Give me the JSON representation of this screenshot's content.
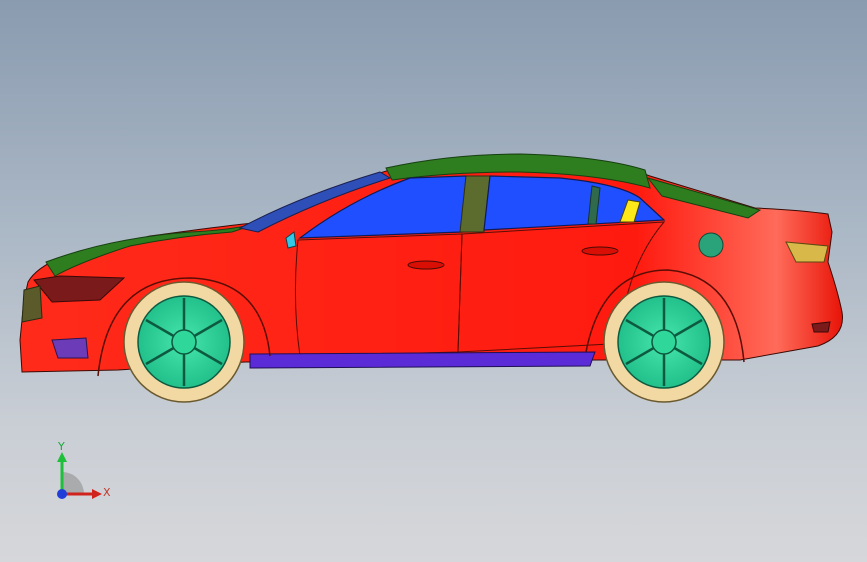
{
  "view": {
    "background_top": "#8a9bb0",
    "background_bottom": "#d6d7da"
  },
  "car": {
    "colors": {
      "body": "#ff1a0f",
      "body_shade": "#e00d06",
      "roof": "#2e7d1f",
      "glass": "#1f4fff",
      "sill": "#5a2bd6",
      "pillar": "#5c6b2e",
      "wheel": "#2fd79b",
      "tire": "#f2d9a4",
      "accent_yellow": "#ffe81a",
      "fuel_cap": "#2aa37a",
      "mirror": "#33c7e8",
      "lamp_dark": "#7a1a1a",
      "fog_lamp": "#6b3bb8"
    }
  },
  "triad": {
    "y_label": "Y",
    "x_label": "X",
    "colors": {
      "x": "#d0231c",
      "y": "#1fbf3c",
      "z": "#1f3fd8"
    }
  }
}
